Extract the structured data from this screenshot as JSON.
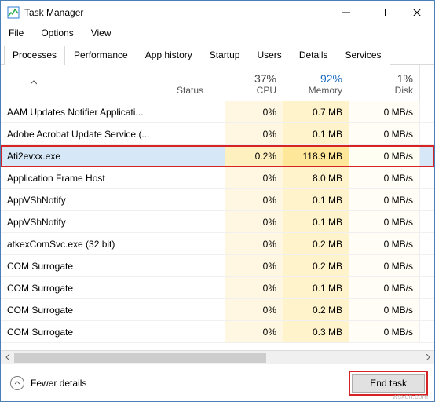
{
  "window": {
    "title": "Task Manager",
    "controls": {
      "min": "minimize",
      "max": "maximize",
      "close": "close"
    }
  },
  "menu": {
    "file": "File",
    "options": "Options",
    "view": "View"
  },
  "tabs": [
    {
      "label": "Processes",
      "active": true
    },
    {
      "label": "Performance",
      "active": false
    },
    {
      "label": "App history",
      "active": false
    },
    {
      "label": "Startup",
      "active": false
    },
    {
      "label": "Users",
      "active": false
    },
    {
      "label": "Details",
      "active": false
    },
    {
      "label": "Services",
      "active": false
    }
  ],
  "columns": {
    "name": {
      "label": "",
      "sort": "asc"
    },
    "status": {
      "label": "Status"
    },
    "cpu": {
      "pct": "37%",
      "label": "CPU"
    },
    "memory": {
      "pct": "92%",
      "label": "Memory"
    },
    "disk": {
      "pct": "1%",
      "label": "Disk"
    }
  },
  "rows": [
    {
      "name": "AAM Updates Notifier Applicati...",
      "cpu": "0%",
      "mem": "0.7 MB",
      "disk": "0 MB/s",
      "selected": false,
      "highlight": false
    },
    {
      "name": "Adobe Acrobat Update Service (...",
      "cpu": "0%",
      "mem": "0.1 MB",
      "disk": "0 MB/s",
      "selected": false,
      "highlight": false
    },
    {
      "name": "Ati2evxx.exe",
      "cpu": "0.2%",
      "mem": "118.9 MB",
      "disk": "0 MB/s",
      "selected": true,
      "highlight": true
    },
    {
      "name": "Application Frame Host",
      "cpu": "0%",
      "mem": "8.0 MB",
      "disk": "0 MB/s",
      "selected": false,
      "highlight": false
    },
    {
      "name": "AppVShNotify",
      "cpu": "0%",
      "mem": "0.1 MB",
      "disk": "0 MB/s",
      "selected": false,
      "highlight": false
    },
    {
      "name": "AppVShNotify",
      "cpu": "0%",
      "mem": "0.1 MB",
      "disk": "0 MB/s",
      "selected": false,
      "highlight": false
    },
    {
      "name": "atkexComSvc.exe (32 bit)",
      "cpu": "0%",
      "mem": "0.2 MB",
      "disk": "0 MB/s",
      "selected": false,
      "highlight": false
    },
    {
      "name": "COM Surrogate",
      "cpu": "0%",
      "mem": "0.2 MB",
      "disk": "0 MB/s",
      "selected": false,
      "highlight": false
    },
    {
      "name": "COM Surrogate",
      "cpu": "0%",
      "mem": "0.1 MB",
      "disk": "0 MB/s",
      "selected": false,
      "highlight": false
    },
    {
      "name": "COM Surrogate",
      "cpu": "0%",
      "mem": "0.2 MB",
      "disk": "0 MB/s",
      "selected": false,
      "highlight": false
    },
    {
      "name": "COM Surrogate",
      "cpu": "0%",
      "mem": "0.3 MB",
      "disk": "0 MB/s",
      "selected": false,
      "highlight": false
    }
  ],
  "footer": {
    "fewer": "Fewer details",
    "end_task": "End task"
  },
  "watermark": "wsxdn.com"
}
